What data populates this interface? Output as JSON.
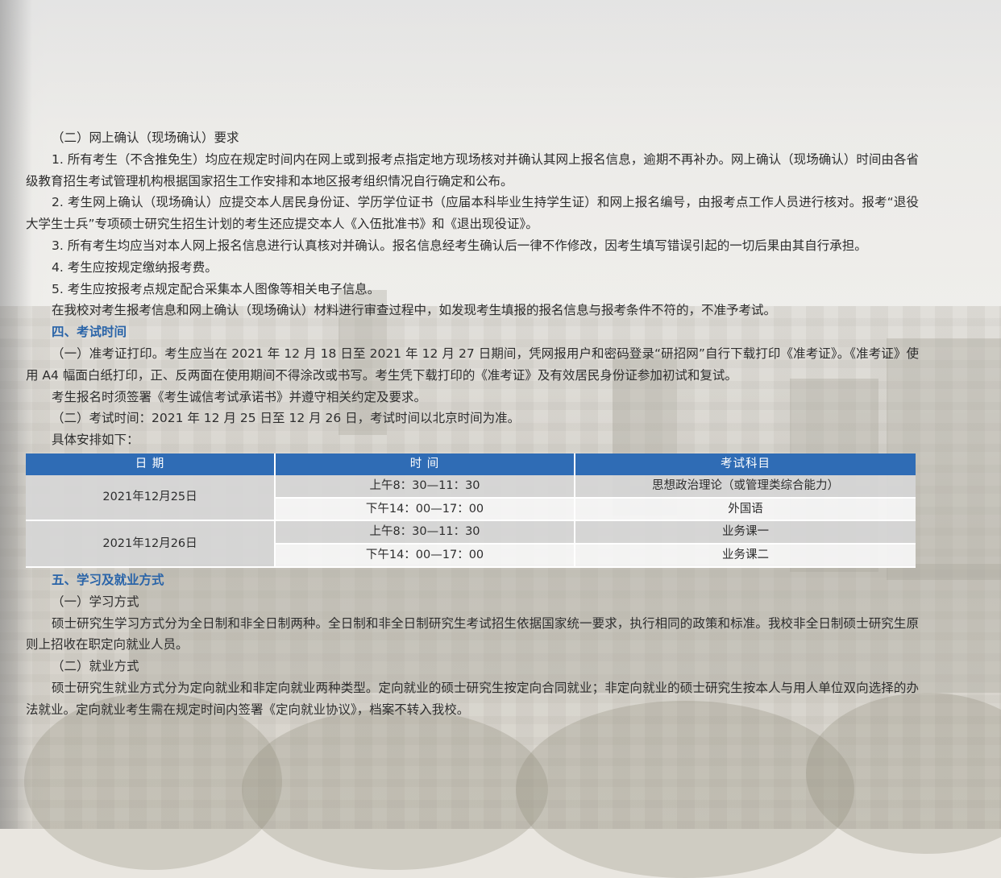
{
  "section_confirm": {
    "heading": "（二）网上确认（现场确认）要求",
    "items": [
      "1. 所有考生（不含推免生）均应在规定时间内在网上或到报考点指定地方现场核对并确认其网上报名信息，逾期不再补办。网上确认（现场确认）时间由各省级教育招生考试管理机构根据国家招生工作安排和本地区报考组织情况自行确定和公布。",
      "2. 考生网上确认（现场确认）应提交本人居民身份证、学历学位证书（应届本科毕业生持学生证）和网上报名编号，由报考点工作人员进行核对。报考“退役大学生士兵”专项硕士研究生招生计划的考生还应提交本人《入伍批准书》和《退出现役证》。",
      "3. 所有考生均应当对本人网上报名信息进行认真核对并确认。报名信息经考生确认后一律不作修改，因考生填写错误引起的一切后果由其自行承担。",
      "4. 考生应按规定缴纳报考费。",
      "5. 考生应按报考点规定配合采集本人图像等相关电子信息。",
      "在我校对考生报考信息和网上确认（现场确认）材料进行审查过程中，如发现考生填报的报名信息与报考条件不符的，不准予考试。"
    ]
  },
  "section_exam": {
    "heading": "四、考试时间",
    "para1": "（一）准考证打印。考生应当在 2021 年 12 月 18 日至 2021 年 12 月 27 日期间，凭网报用户和密码登录“研招网”自行下载打印《准考证》。《准考证》使用 A4 幅面白纸打印，正、反两面在使用期间不得涂改或书写。考生凭下载打印的《准考证》及有效居民身份证参加初试和复试。",
    "para2": "考生报名时须签署《考生诚信考试承诺书》并遵守相关约定及要求。",
    "para3": "（二）考试时间：2021 年 12 月 25 日至 12 月 26 日，考试时间以北京时间为准。",
    "para4": "具体安排如下："
  },
  "schedule_table": {
    "headers": [
      "日 期",
      "时 间",
      "考试科目"
    ],
    "days": [
      {
        "date": "2021年12月25日",
        "sessions": [
          {
            "time": "上午8：30—11：30",
            "subject": "思想政治理论（或管理类综合能力）"
          },
          {
            "time": "下午14：00—17：00",
            "subject": "外国语"
          }
        ]
      },
      {
        "date": "2021年12月26日",
        "sessions": [
          {
            "time": "上午8：30—11：30",
            "subject": "业务课一"
          },
          {
            "time": "下午14：00—17：00",
            "subject": "业务课二"
          }
        ]
      }
    ]
  },
  "section_study": {
    "heading": "五、学习及就业方式",
    "sub1": "（一）学习方式",
    "text1": "硕士研究生学习方式分为全日制和非全日制两种。全日制和非全日制研究生考试招生依据国家统一要求，执行相同的政策和标准。我校非全日制硕士研究生原则上招收在职定向就业人员。",
    "sub2": "（二）就业方式",
    "text2": "硕士研究生就业方式分为定向就业和非定向就业两种类型。定向就业的硕士研究生按定向合同就业；非定向就业的硕士研究生按本人与用人单位双向选择的办法就业。定向就业考生需在规定时间内签署《定向就业协议》，档案不转入我校。"
  },
  "colors": {
    "heading_blue": "#2a64a8",
    "table_header_blue": "#2f6cb5"
  }
}
